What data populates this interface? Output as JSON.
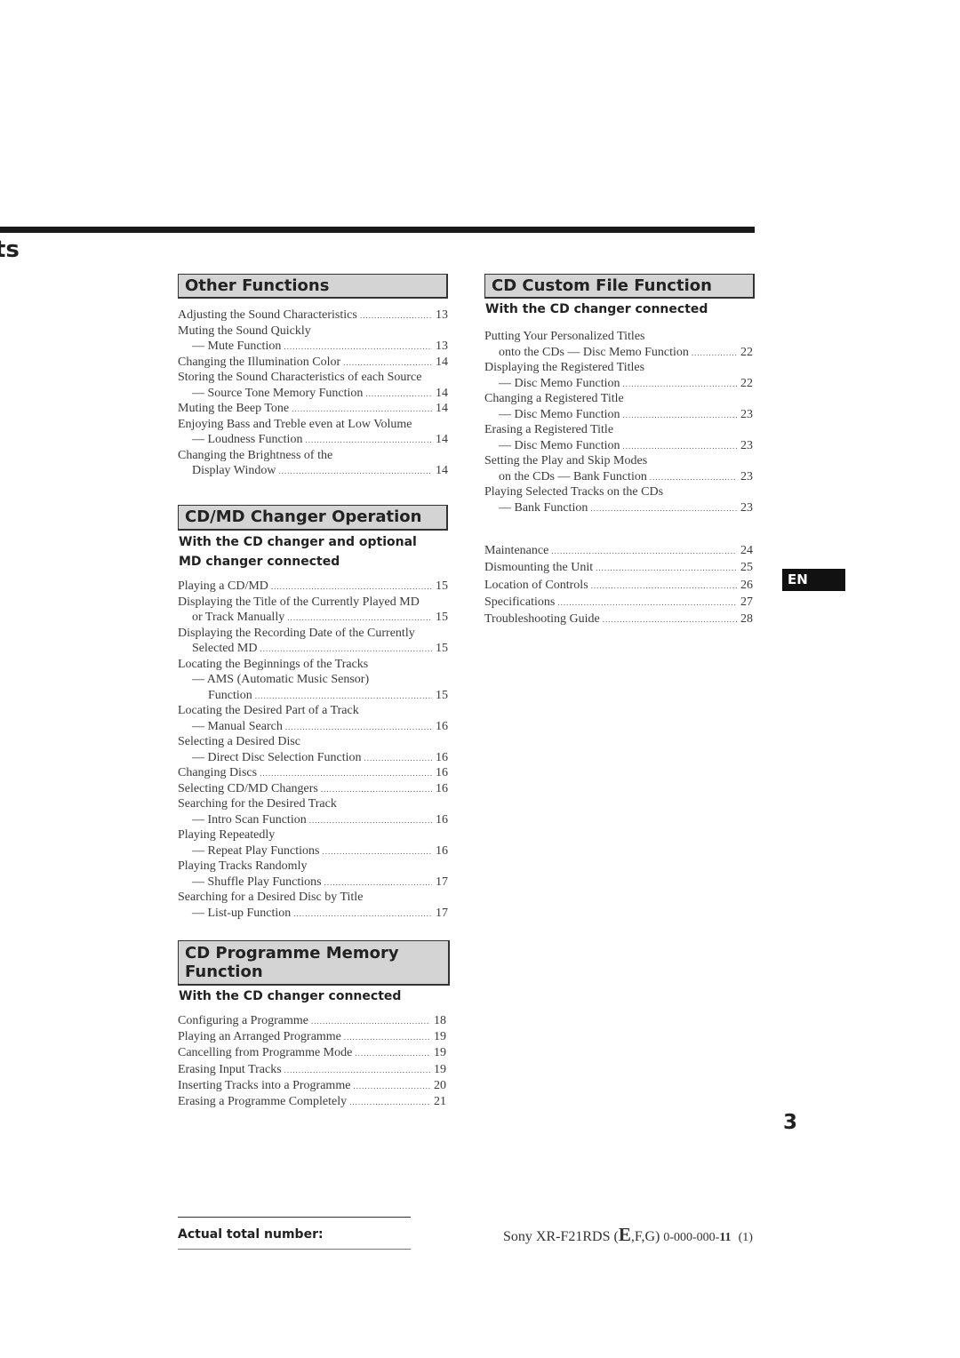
{
  "header": {
    "title_fragment": "ts"
  },
  "sections": {
    "other": {
      "title": "Other Functions",
      "entries": [
        [
          {
            "text": "Adjusting the Sound Characteristics",
            "page": "13"
          }
        ],
        [
          {
            "text": "Muting the Sound Quickly"
          },
          {
            "text": "— Mute Function",
            "level": 1,
            "page": "13"
          }
        ],
        [
          {
            "text": "Changing the Illumination Color",
            "page": "14"
          }
        ],
        [
          {
            "text": "Storing the Sound Characteristics of each Source"
          },
          {
            "text": "— Source Tone Memory Function",
            "level": 1,
            "page": "14"
          }
        ],
        [
          {
            "text": "Muting the Beep Tone",
            "page": "14"
          }
        ],
        [
          {
            "text": "Enjoying Bass and Treble even at Low Volume"
          },
          {
            "text": "— Loudness Function",
            "level": 1,
            "page": "14"
          }
        ],
        [
          {
            "text": "Changing the Brightness of the"
          },
          {
            "text": "Display Window",
            "level": 1,
            "page": "14"
          }
        ]
      ]
    },
    "cdmd": {
      "title": "CD/MD Changer Operation",
      "subtitle_1": "With the CD changer and optional",
      "subtitle_2": "MD changer connected",
      "entries": [
        [
          {
            "text": "Playing a CD/MD",
            "page": "15"
          }
        ],
        [
          {
            "text": "Displaying the Title of the Currently Played MD"
          },
          {
            "text": "or Track Manually",
            "level": 1,
            "page": "15"
          }
        ],
        [
          {
            "text": "Displaying the Recording Date of the Currently"
          },
          {
            "text": "Selected MD",
            "level": 1,
            "page": "15"
          }
        ],
        [
          {
            "text": "Locating the Beginnings of the Tracks"
          },
          {
            "text": "— AMS (Automatic Music Sensor)",
            "level": 1
          },
          {
            "text": "Function",
            "level": 2,
            "page": "15"
          }
        ],
        [
          {
            "text": "Locating the Desired Part of a Track"
          },
          {
            "text": "— Manual Search",
            "level": 1,
            "page": "16"
          }
        ],
        [
          {
            "text": "Selecting a Desired Disc"
          },
          {
            "text": "— Direct Disc Selection Function",
            "level": 1,
            "page": "16"
          }
        ],
        [
          {
            "text": "Changing Discs",
            "page": "16"
          }
        ],
        [
          {
            "text": "Selecting CD/MD Changers",
            "page": "16"
          }
        ],
        [
          {
            "text": "Searching for the Desired Track"
          },
          {
            "text": "— Intro Scan Function",
            "level": 1,
            "page": "16"
          }
        ],
        [
          {
            "text": "Playing Repeatedly"
          },
          {
            "text": "— Repeat Play Functions",
            "level": 1,
            "page": "16"
          }
        ],
        [
          {
            "text": "Playing Tracks Randomly"
          },
          {
            "text": "— Shuffle Play Functions",
            "level": 1,
            "page": "17"
          }
        ],
        [
          {
            "text": "Searching for a Desired Disc by Title"
          },
          {
            "text": "— List-up Function",
            "level": 1,
            "page": "17"
          }
        ]
      ]
    },
    "programme": {
      "title_1": "CD Programme Memory",
      "title_2": "Function",
      "subtitle": "With the CD changer connected",
      "entries": [
        [
          {
            "text": "Configuring a Programme",
            "page": "18"
          }
        ],
        [
          {
            "text": "Playing an Arranged Programme",
            "page": "19"
          }
        ],
        [
          {
            "text": "Cancelling from Programme Mode",
            "page": "19"
          }
        ],
        [
          {
            "text": "Erasing Input Tracks",
            "page": "19"
          }
        ],
        [
          {
            "text": "Inserting Tracks into a Programme",
            "page": "20"
          }
        ],
        [
          {
            "text": "Erasing a Programme Completely",
            "page": "21"
          }
        ]
      ]
    },
    "custom": {
      "title": "CD Custom File Function",
      "subtitle": "With the CD changer connected",
      "entries": [
        [
          {
            "text": "Putting Your Personalized Titles"
          },
          {
            "text": "onto the CDs  — Disc Memo Function",
            "level": 1,
            "page": "22"
          }
        ],
        [
          {
            "text": "Displaying the Registered Titles"
          },
          {
            "text": "— Disc Memo Function",
            "level": 1,
            "page": "22"
          }
        ],
        [
          {
            "text": "Changing a Registered Title"
          },
          {
            "text": "— Disc Memo Function",
            "level": 1,
            "page": "23"
          }
        ],
        [
          {
            "text": "Erasing a Registered Title"
          },
          {
            "text": "— Disc Memo Function",
            "level": 1,
            "page": "23"
          }
        ],
        [
          {
            "text": "Setting the Play and Skip Modes"
          },
          {
            "text": "on the CDs — Bank Function",
            "level": 1,
            "page": "23"
          }
        ],
        [
          {
            "text": "Playing Selected Tracks on the CDs"
          },
          {
            "text": "— Bank Function",
            "level": 1,
            "page": "23"
          }
        ]
      ]
    },
    "misc": {
      "entries": [
        [
          {
            "text": "Maintenance",
            "page": "24"
          }
        ],
        [
          {
            "text": "Dismounting the Unit",
            "page": "25"
          }
        ],
        [
          {
            "text": "Location of Controls",
            "page": "26"
          }
        ],
        [
          {
            "text": "Specifications",
            "page": "27"
          }
        ],
        [
          {
            "text": "Troubleshooting Guide",
            "page": "28"
          }
        ]
      ]
    }
  },
  "language_tab": "EN",
  "page_number": "3",
  "footer": {
    "label": "Actual total number:",
    "model_prefix": "Sony XR-F21RDS (",
    "model_big": "E",
    "model_suffix": ",F,G)",
    "code_prefix": "0-000-000-",
    "code_bold": "11",
    "code_suffix": "(1)"
  }
}
